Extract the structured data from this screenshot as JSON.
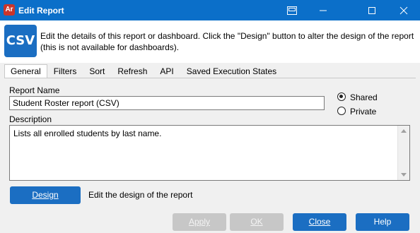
{
  "window": {
    "app_icon_text": "Ar",
    "title": "Edit Report"
  },
  "header": {
    "logo_text": "CSV",
    "description": "Edit the details of this report or dashboard.  Click the \"Design\" button to alter the design of the report (this is not available for dashboards)."
  },
  "tabs": [
    {
      "label": "General",
      "active": true
    },
    {
      "label": "Filters"
    },
    {
      "label": "Sort"
    },
    {
      "label": "Refresh"
    },
    {
      "label": "API"
    },
    {
      "label": "Saved Execution States"
    }
  ],
  "general": {
    "report_name_label": "Report Name",
    "report_name_value": "Student Roster report (CSV)",
    "description_label": "Description",
    "description_value": "Lists all enrolled students by last name.",
    "visibility": {
      "shared_label": "Shared",
      "private_label": "Private",
      "selected": "Shared"
    },
    "design_button_label": "Design",
    "design_hint": "Edit the design of the report"
  },
  "footer": {
    "apply_label": "Apply",
    "ok_label": "OK",
    "close_label": "Close",
    "help_label": "Help"
  },
  "colors": {
    "titlebar": "#0b6fc9",
    "accent": "#1b6ec2"
  }
}
